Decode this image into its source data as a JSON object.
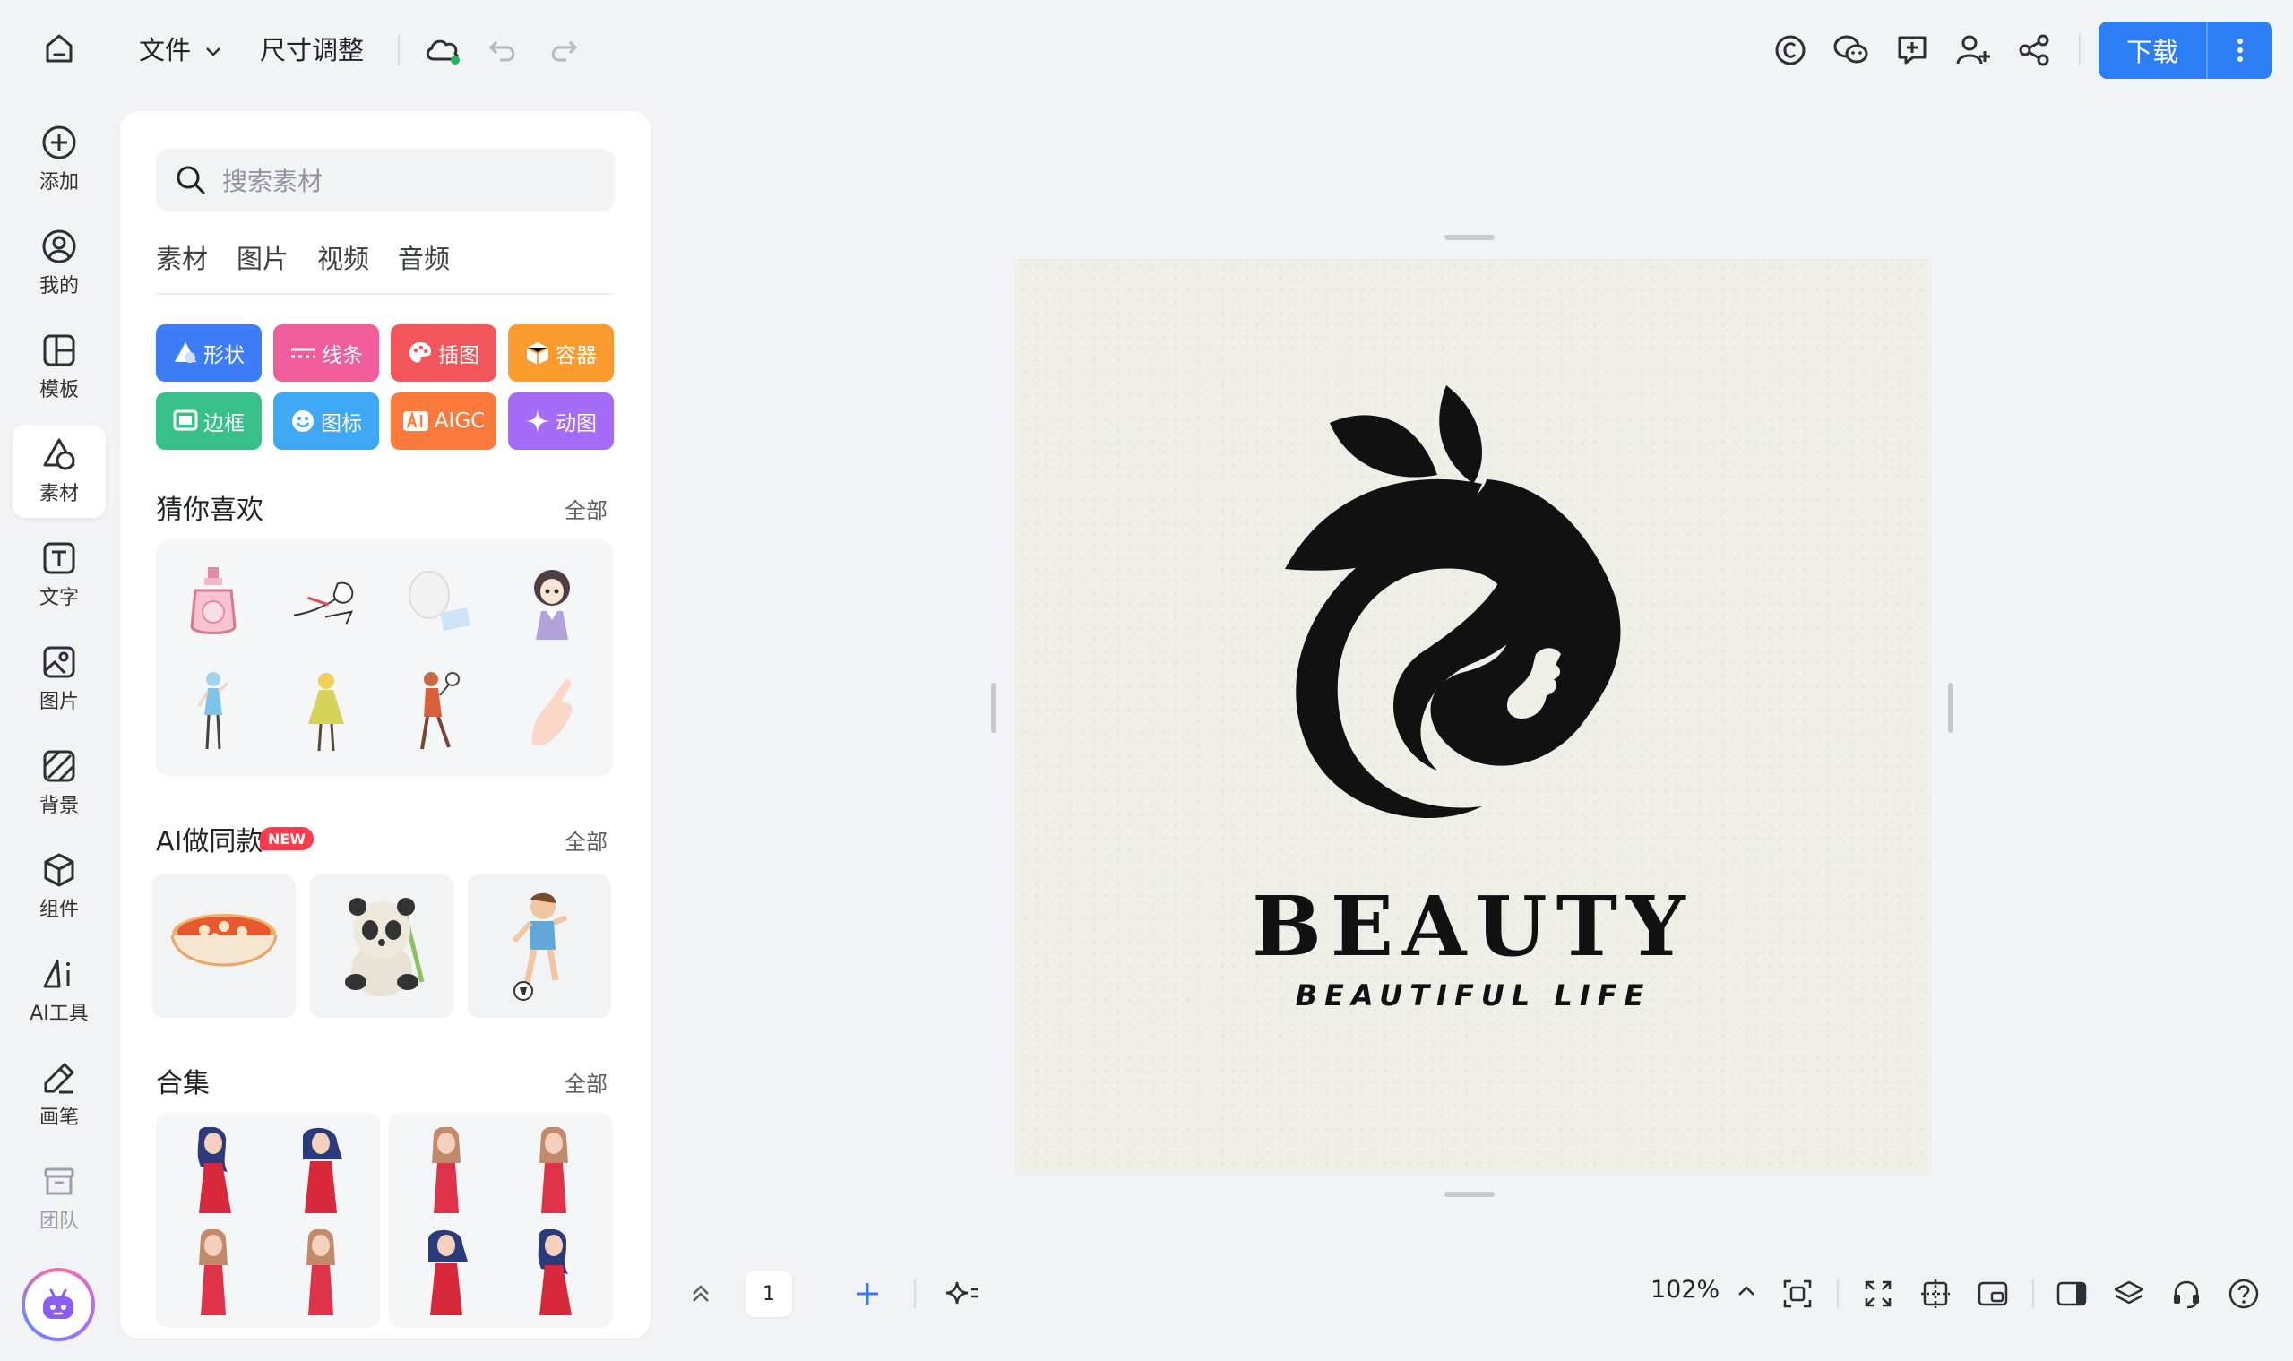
{
  "topbar": {
    "file_menu": "文件",
    "resize": "尺寸调整",
    "download": "下载"
  },
  "rail": [
    {
      "label": "添加"
    },
    {
      "label": "我的"
    },
    {
      "label": "模板"
    },
    {
      "label": "素材"
    },
    {
      "label": "文字"
    },
    {
      "label": "图片"
    },
    {
      "label": "背景"
    },
    {
      "label": "组件"
    },
    {
      "label": "AI工具"
    },
    {
      "label": "画笔"
    },
    {
      "label": "团队"
    }
  ],
  "panel": {
    "search_placeholder": "搜索素材",
    "tabs": [
      "素材",
      "图片",
      "视频",
      "音频"
    ],
    "categories": [
      {
        "label": "形状",
        "color": "#3d7ef7"
      },
      {
        "label": "线条",
        "color": "#f15c9a"
      },
      {
        "label": "插图",
        "color": "#f3565a"
      },
      {
        "label": "容器",
        "color": "#fb9b2e"
      },
      {
        "label": "边框",
        "color": "#38c08a"
      },
      {
        "label": "图标",
        "color": "#3ea8f5"
      },
      {
        "label": "AIGC",
        "color": "#fb7a3c"
      },
      {
        "label": "动图",
        "color": "#a56cf7"
      }
    ],
    "guess_title": "猜你喜欢",
    "ai_title": "AI做同款",
    "new_badge": "NEW",
    "collection_title": "合集",
    "all_label": "全部"
  },
  "canvas": {
    "brand": "BEAUTY",
    "tagline": "BEAUTIFUL LIFE"
  },
  "bottombar": {
    "page_number": "1",
    "zoom": "102%"
  },
  "colors": {
    "accent": "#2d7df6",
    "background": "#f2f3f7"
  }
}
